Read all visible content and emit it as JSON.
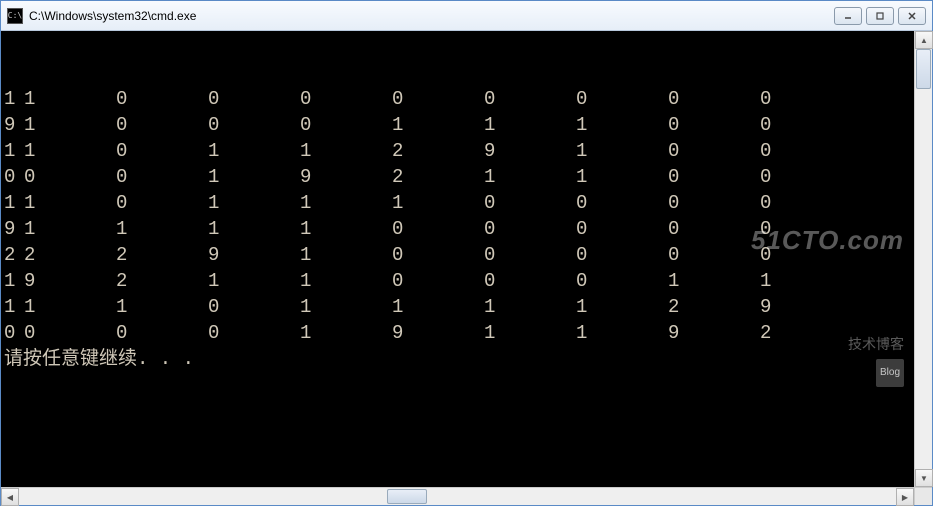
{
  "window": {
    "title": "C:\\Windows\\system32\\cmd.exe"
  },
  "grid": {
    "rows": [
      [
        1,
        1,
        0,
        0,
        0,
        0,
        0,
        0,
        0,
        0
      ],
      [
        9,
        1,
        0,
        0,
        0,
        1,
        1,
        1,
        0,
        0
      ],
      [
        1,
        1,
        0,
        1,
        1,
        2,
        9,
        1,
        0,
        0
      ],
      [
        0,
        0,
        0,
        1,
        9,
        2,
        1,
        1,
        0,
        0
      ],
      [
        1,
        1,
        0,
        1,
        1,
        1,
        0,
        0,
        0,
        0
      ],
      [
        9,
        1,
        1,
        1,
        1,
        0,
        0,
        0,
        0,
        0
      ],
      [
        2,
        2,
        2,
        9,
        1,
        0,
        0,
        0,
        0,
        0
      ],
      [
        1,
        9,
        2,
        1,
        1,
        0,
        0,
        0,
        1,
        1
      ],
      [
        1,
        1,
        1,
        0,
        1,
        1,
        1,
        1,
        2,
        9
      ],
      [
        0,
        0,
        0,
        0,
        1,
        9,
        1,
        1,
        9,
        2
      ]
    ]
  },
  "prompt": "请按任意键继续. . .",
  "watermark": {
    "line1": "51CTO.com",
    "line2": "技术博客",
    "badge": "Blog"
  }
}
